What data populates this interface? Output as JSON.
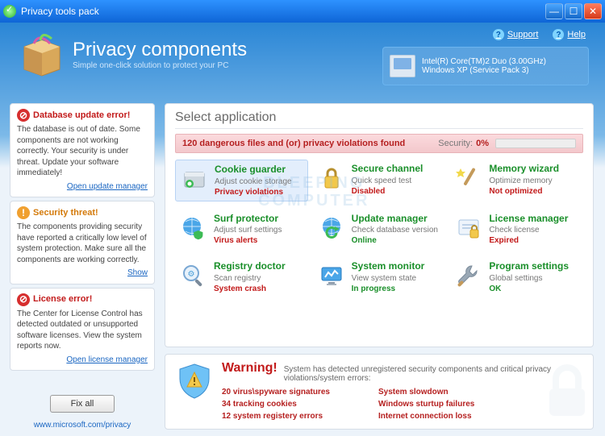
{
  "window": {
    "title": "Privacy tools pack"
  },
  "toplinks": {
    "support": "Support",
    "help": "Help"
  },
  "brand": {
    "title": "Privacy components",
    "subtitle": "Simple one-click solution to protect your PC"
  },
  "sysinfo": {
    "cpu": "Intel(R) Core(TM)2 Duo  (3.00GHz)",
    "os": "Windows XP  (Service Pack 3)"
  },
  "sidebar": {
    "alerts": [
      {
        "title": "Database update error!",
        "body": "The database is out of date. Some components are not working correctly. Your security is under threat. Update your software immediately!",
        "link": "Open update manager",
        "kind": "red"
      },
      {
        "title": "Security threat!",
        "body": "The components providing security have reported a critically low level of system protection. Make sure all the components are working correctly.",
        "link": "Show",
        "kind": "orange"
      },
      {
        "title": "License error!",
        "body": "The Center for License Control has detected outdated or unsupported software licenses. View the system reports now.",
        "link": "Open license manager",
        "kind": "red"
      }
    ],
    "fixall": "Fix all",
    "mslink": "www.microsoft.com/privacy"
  },
  "main": {
    "heading": "Select application",
    "status": {
      "text": "120 dangerous files and (or) privacy violations found",
      "label": "Security:",
      "value": "0%"
    },
    "apps": [
      {
        "name": "Cookie guarder",
        "desc": "Adjust cookie storage",
        "state": "Privacy violations",
        "state_kind": "red",
        "icon": "cookie",
        "selected": true
      },
      {
        "name": "Secure channel",
        "desc": "Quick speed test",
        "state": "Disabled",
        "state_kind": "red",
        "icon": "lock"
      },
      {
        "name": "Memory wizard",
        "desc": "Optimize memory",
        "state": "Not optimized",
        "state_kind": "red",
        "icon": "wand"
      },
      {
        "name": "Surf protector",
        "desc": "Adjust surf settings",
        "state": "Virus alerts",
        "state_kind": "red",
        "icon": "globe-shield"
      },
      {
        "name": "Update manager",
        "desc": "Check database version",
        "state": "Online",
        "state_kind": "green",
        "icon": "globe-refresh"
      },
      {
        "name": "License manager",
        "desc": "Check license",
        "state": "Expired",
        "state_kind": "red",
        "icon": "license"
      },
      {
        "name": "Registry doctor",
        "desc": "Scan registry",
        "state": "System crash",
        "state_kind": "red",
        "icon": "magnify"
      },
      {
        "name": "System monitor",
        "desc": "View system state",
        "state": "In progress",
        "state_kind": "green",
        "icon": "monitor"
      },
      {
        "name": "Program settings",
        "desc": "Global settings",
        "state": "OK",
        "state_kind": "green",
        "icon": "wrench"
      }
    ]
  },
  "warning": {
    "title": "Warning!",
    "desc": "System has detected  unregistered security components and critical privacy violations/system errors:",
    "left": [
      "20 virus\\spyware signatures",
      "34 tracking cookies",
      "12 system registery errors"
    ],
    "right": [
      "System slowdown",
      "Windows sturtup failures",
      "Internet connection loss"
    ]
  },
  "watermark": {
    "line1": "BLEEPING",
    "line2": "COMPUTER"
  }
}
